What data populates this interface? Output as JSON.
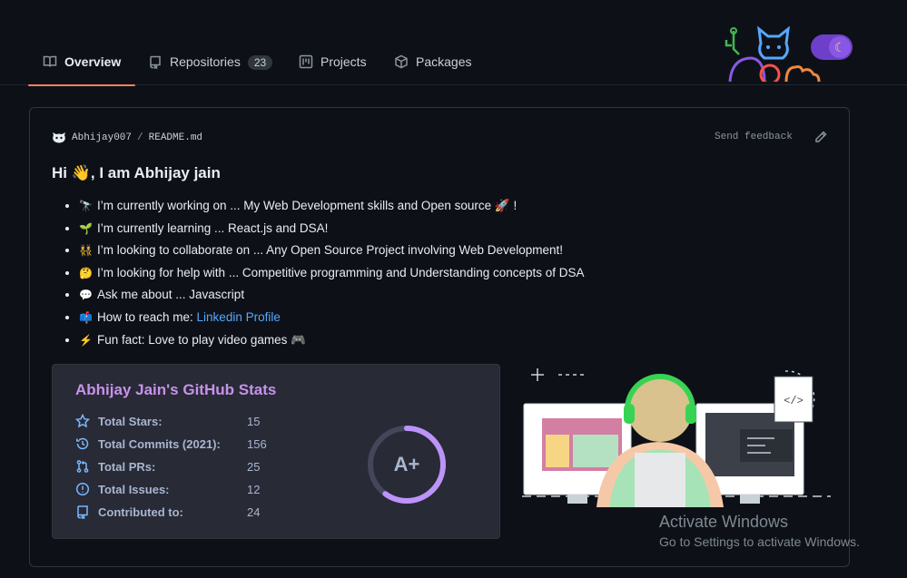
{
  "nav": {
    "tabs": [
      {
        "label": "Overview",
        "icon": "book-icon",
        "active": true
      },
      {
        "label": "Repositories",
        "icon": "repo-icon",
        "count": "23"
      },
      {
        "label": "Projects",
        "icon": "project-icon"
      },
      {
        "label": "Packages",
        "icon": "package-icon"
      }
    ]
  },
  "readme": {
    "owner": "Abhijay007",
    "file": "README.md",
    "feedback": "Send feedback",
    "greeting_pre": "Hi ",
    "greeting_emoji": "👋",
    "greeting_post": ", I am Abhijay jain",
    "items": [
      {
        "emoji": "🔭",
        "text": "I’m currently working on ... My Web Development skills and Open source 🚀 !"
      },
      {
        "emoji": "🌱",
        "text": "I’m currently learning ... React.js and DSA!"
      },
      {
        "emoji": "👯",
        "text": "I’m looking to collaborate on ... Any Open Source Project involving Web Development!"
      },
      {
        "emoji": "🤔",
        "text": "I’m looking for help with ... Competitive programming and Understanding concepts of DSA"
      },
      {
        "emoji": "💬",
        "text": "Ask me about ... Javascript"
      },
      {
        "emoji": "📫",
        "text": "How to reach me: ",
        "link": "Linkedin Profile"
      },
      {
        "emoji": "⚡",
        "text": "Fun fact: Love to play video games 🎮"
      }
    ]
  },
  "stats": {
    "title": "Abhijay Jain's GitHub Stats",
    "rows": [
      {
        "label": "Total Stars:",
        "value": "15",
        "icon": "star-icon"
      },
      {
        "label": "Total Commits (2021):",
        "value": "156",
        "icon": "history-icon"
      },
      {
        "label": "Total PRs:",
        "value": "25",
        "icon": "pull-request-icon"
      },
      {
        "label": "Total Issues:",
        "value": "12",
        "icon": "issue-icon"
      },
      {
        "label": "Contributed to:",
        "value": "24",
        "icon": "repo-icon"
      }
    ],
    "grade": "A+",
    "grade_progress": 0.6,
    "accent": "#c792ea",
    "ring_color": "#bd93f9"
  },
  "watermark": {
    "line1": "Activate Windows",
    "line2": "Go to Settings to activate Windows."
  },
  "colors": {
    "background": "#0d1117",
    "active_tab_underline": "#f78166",
    "link": "#58a6ff",
    "stats_card": "#282a36"
  }
}
